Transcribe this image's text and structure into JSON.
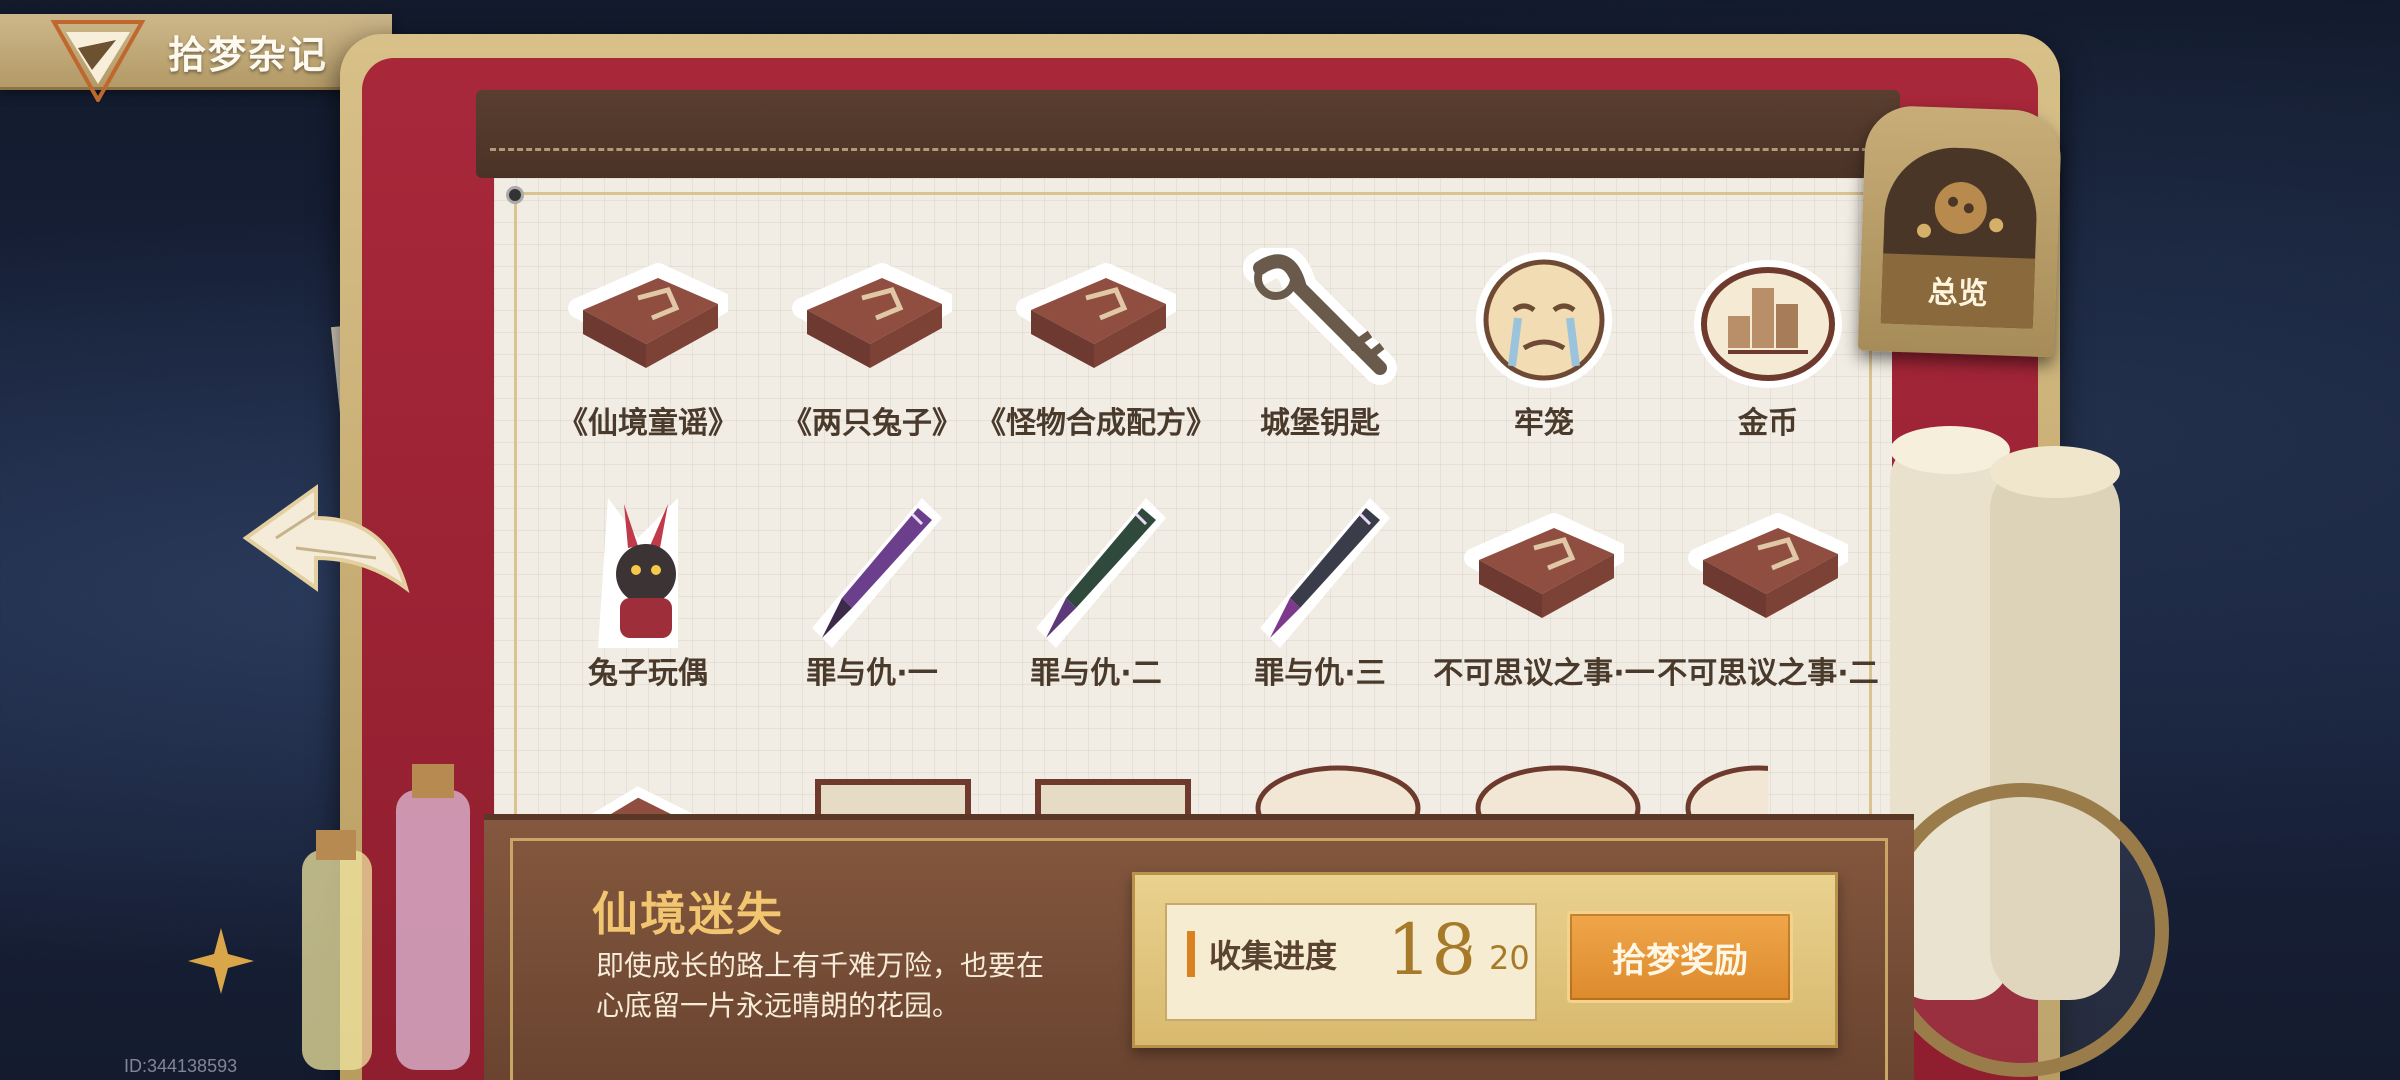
{
  "header": {
    "title": "拾梦杂记"
  },
  "overview": {
    "label": "总览"
  },
  "items": [
    {
      "label": "《仙境童谣》",
      "icon": "book-icon"
    },
    {
      "label": "《两只兔子》",
      "icon": "book-icon"
    },
    {
      "label": "《怪物合成配方》",
      "icon": "book-icon"
    },
    {
      "label": "城堡钥匙",
      "icon": "key-icon"
    },
    {
      "label": "牢笼",
      "icon": "crying-face-icon"
    },
    {
      "label": "金币",
      "icon": "coins-icon"
    },
    {
      "label": "兔子玩偶",
      "icon": "rabbit-doll-icon"
    },
    {
      "label": "罪与仇·一",
      "icon": "dagger-icon"
    },
    {
      "label": "罪与仇·二",
      "icon": "dagger-icon"
    },
    {
      "label": "罪与仇·三",
      "icon": "dagger-icon"
    },
    {
      "label": "不可思议之事·一",
      "icon": "book-icon"
    },
    {
      "label": "不可思议之事·二",
      "icon": "book-icon"
    }
  ],
  "chapter": {
    "title": "仙境迷失",
    "description_line1": "即使成长的路上有千难万险，也要在",
    "description_line2": "心底留一片永远晴朗的花园。"
  },
  "progress": {
    "label": "收集进度",
    "current": "18",
    "separator": "/",
    "total": "20",
    "value_fraction": 0.9
  },
  "reward_button": {
    "label": "拾梦奖励"
  },
  "footer": {
    "id_text": "ID:344138593"
  },
  "colors": {
    "frame_gold": "#d8c089",
    "frame_red": "#a8283a",
    "leather": "#5a3f30",
    "paper": "#f1ede4",
    "chapter_title": "#f2c671",
    "button_orange": "#f0a64a"
  }
}
